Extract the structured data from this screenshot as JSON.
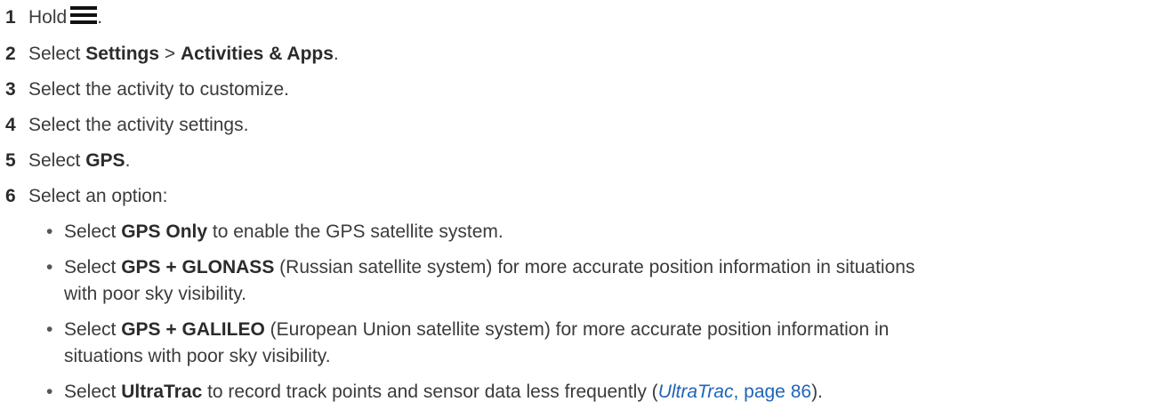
{
  "steps": [
    {
      "num": "1",
      "pre": "Hold",
      "post": ".",
      "icon": "menu-icon"
    },
    {
      "num": "2",
      "pre": "Select ",
      "b1": "Settings",
      "mid": " > ",
      "b2": "Activities & Apps",
      "post": "."
    },
    {
      "num": "3",
      "text": "Select the activity to customize."
    },
    {
      "num": "4",
      "text": "Select the activity settings."
    },
    {
      "num": "5",
      "pre": "Select ",
      "b1": "GPS",
      "post": "."
    },
    {
      "num": "6",
      "text": "Select an option:"
    }
  ],
  "options": [
    {
      "pre": "Select ",
      "bold": "GPS Only",
      "post": " to enable the GPS satellite system."
    },
    {
      "pre": "Select ",
      "bold": "GPS + GLONASS",
      "post": " (Russian satellite system) for more accurate position information in situations",
      "line2": "with poor sky visibility."
    },
    {
      "pre": "Select ",
      "bold": "GPS + GALILEO",
      "post": " (European Union satellite system) for more accurate position information in",
      "line2": "situations with poor sky visibility."
    },
    {
      "pre": "Select ",
      "bold": "UltraTrac",
      "post": " to record track points and sensor data less frequently (",
      "link_italic": "UltraTrac",
      "link_rest": ", page 86",
      "end": ")."
    }
  ],
  "bullet": "•"
}
